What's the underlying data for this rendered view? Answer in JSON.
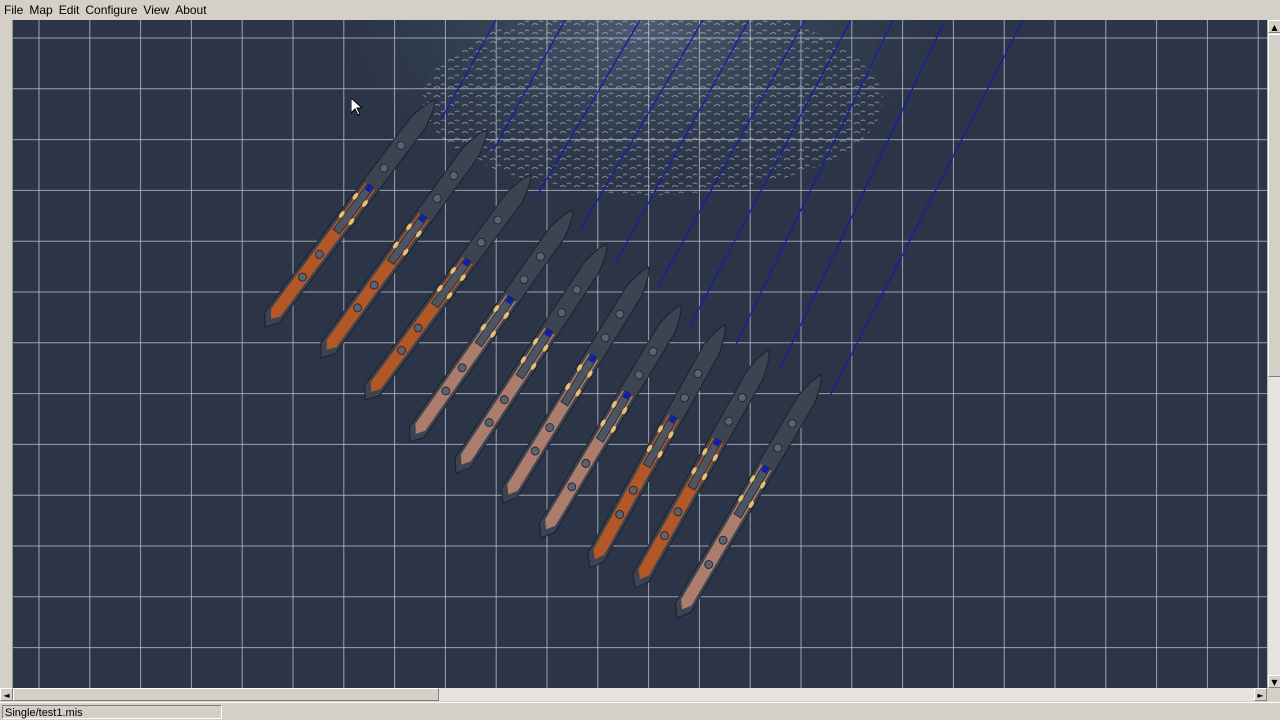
{
  "menubar": {
    "items": [
      {
        "label": "File"
      },
      {
        "label": "Map"
      },
      {
        "label": "Edit"
      },
      {
        "label": "Configure"
      },
      {
        "label": "View"
      },
      {
        "label": "About"
      }
    ]
  },
  "statusbar": {
    "file": "Single/test1.mis"
  },
  "map": {
    "background_color": "#2b3547",
    "grid_color": "#c8d0dc",
    "route_color": "#1a1aa8",
    "ship_count": 10,
    "icons": [
      "ship-icon",
      "route-line",
      "grid-line"
    ]
  },
  "scrollbars": {
    "up_arrow": "▲",
    "down_arrow": "▼",
    "left_arrow": "◄",
    "right_arrow": "►"
  }
}
